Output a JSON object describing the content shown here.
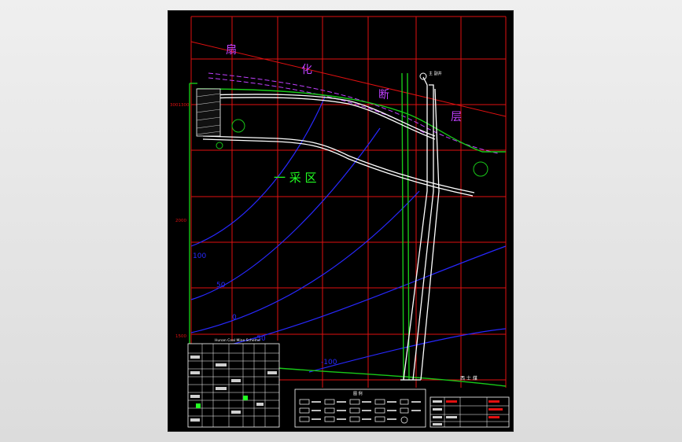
{
  "drawing": {
    "fault_label_chars": [
      "扇",
      "化",
      "断",
      "层"
    ],
    "zone_label": "一 采 区",
    "contour_labels": [
      "100",
      "50",
      "0",
      "-50",
      "-100"
    ],
    "left_axis_labels": [
      "3001300",
      "2000",
      "1500"
    ],
    "shaft_label": "主 副井",
    "coal_label": "西 士 煤",
    "table_title": "Hunan Coal Mine Scheme",
    "legend_title": "图 例",
    "colors": {
      "grid": "#e01010",
      "boundary": "#18c818",
      "contour": "#2828ff",
      "fault": "#c040ff",
      "roadway": "#ffffff",
      "zone_text": "#22ff22",
      "frame": "#ffffff",
      "background": "#000000"
    }
  }
}
